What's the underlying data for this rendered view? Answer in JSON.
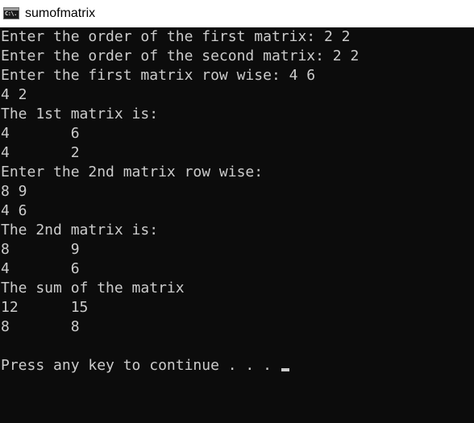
{
  "window": {
    "title": "sumofmatrix",
    "icon": "console-app-icon",
    "icon_text": "C:\\."
  },
  "console": {
    "lines": [
      "Enter the order of the first matrix: 2 2",
      "Enter the order of the second matrix: 2 2",
      "Enter the first matrix row wise: 4 6",
      "4 2",
      "The 1st matrix is:",
      "4       6",
      "4       2",
      "Enter the 2nd matrix row wise:",
      "8 9",
      "4 6",
      "The 2nd matrix is:",
      "8       9",
      "4       6",
      "The sum of the matrix",
      "12      15",
      "8       8",
      "",
      "Press any key to continue . . . "
    ],
    "text_color": "#cccccc",
    "background_color": "#0c0c0c"
  }
}
